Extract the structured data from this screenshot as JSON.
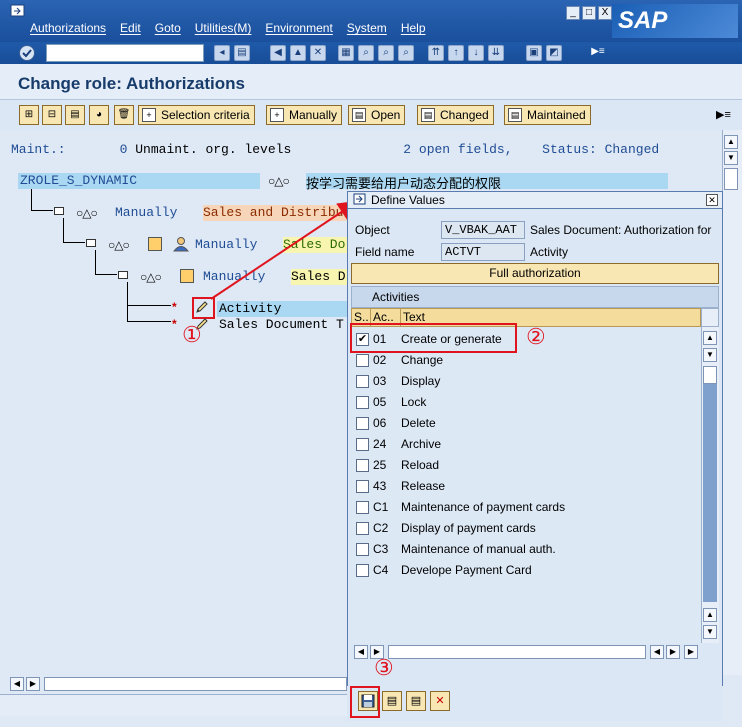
{
  "menu": {
    "items": [
      "Authorizations",
      "Edit",
      "Goto",
      "Utilities(M)",
      "Environment",
      "System",
      "Help"
    ]
  },
  "window_buttons": [
    "_",
    "□",
    "X"
  ],
  "logo_text": "SAP",
  "page_title": "Change role: Authorizations",
  "app_toolbar": {
    "selection_criteria": "Selection criteria",
    "manually": "Manually",
    "open": "Open",
    "changed": "Changed",
    "maintained": "Maintained"
  },
  "status_line": {
    "maint_label": "Maint.:",
    "maint_count": "0",
    "unmaint_label": "Unmaint. org. levels",
    "open_count": "2",
    "open_label": "open fields,",
    "status_label": "Status:",
    "status_value": "Changed"
  },
  "tree": {
    "root_name": "ZROLE_S_DYNAMIC",
    "root_desc": "按学习需要给用户动态分配的权限",
    "level1_label": "Manually",
    "level1_desc": "Sales and Distribu",
    "level2_label": "Manually",
    "level2_desc": "Sales Do",
    "level3_label": "Manually",
    "level3_desc": "Sales D",
    "field1": "Activity",
    "field2": "Sales Document T",
    "star": "*"
  },
  "dialog": {
    "title": "Define Values",
    "object_label": "Object",
    "object_value": "V_VBAK_AAT",
    "object_desc": "Sales Document: Authorization for",
    "field_label": "Field name",
    "field_value": "ACTVT",
    "field_desc": "Activity",
    "full_auth": "Full authorization",
    "table_caption": "Activities",
    "columns": [
      "S..",
      "Ac..",
      "Text"
    ],
    "rows": [
      {
        "code": "01",
        "text": "Create or generate",
        "checked": true
      },
      {
        "code": "02",
        "text": "Change",
        "checked": false
      },
      {
        "code": "03",
        "text": "Display",
        "checked": false
      },
      {
        "code": "05",
        "text": "Lock",
        "checked": false
      },
      {
        "code": "06",
        "text": "Delete",
        "checked": false
      },
      {
        "code": "24",
        "text": "Archive",
        "checked": false
      },
      {
        "code": "25",
        "text": "Reload",
        "checked": false
      },
      {
        "code": "43",
        "text": "Release",
        "checked": false
      },
      {
        "code": "C1",
        "text": "Maintenance of payment cards",
        "checked": false
      },
      {
        "code": "C2",
        "text": "Display of payment cards",
        "checked": false
      },
      {
        "code": "C3",
        "text": "Maintenance of manual auth.",
        "checked": false
      },
      {
        "code": "C4",
        "text": "Develope Payment Card",
        "checked": false
      }
    ]
  },
  "annotations": [
    "①",
    "②",
    "③"
  ],
  "colors": {
    "accent_red": "#e0141e",
    "sap_blue": "#1f5aa9",
    "button_yellow": "#f8e7b3"
  }
}
